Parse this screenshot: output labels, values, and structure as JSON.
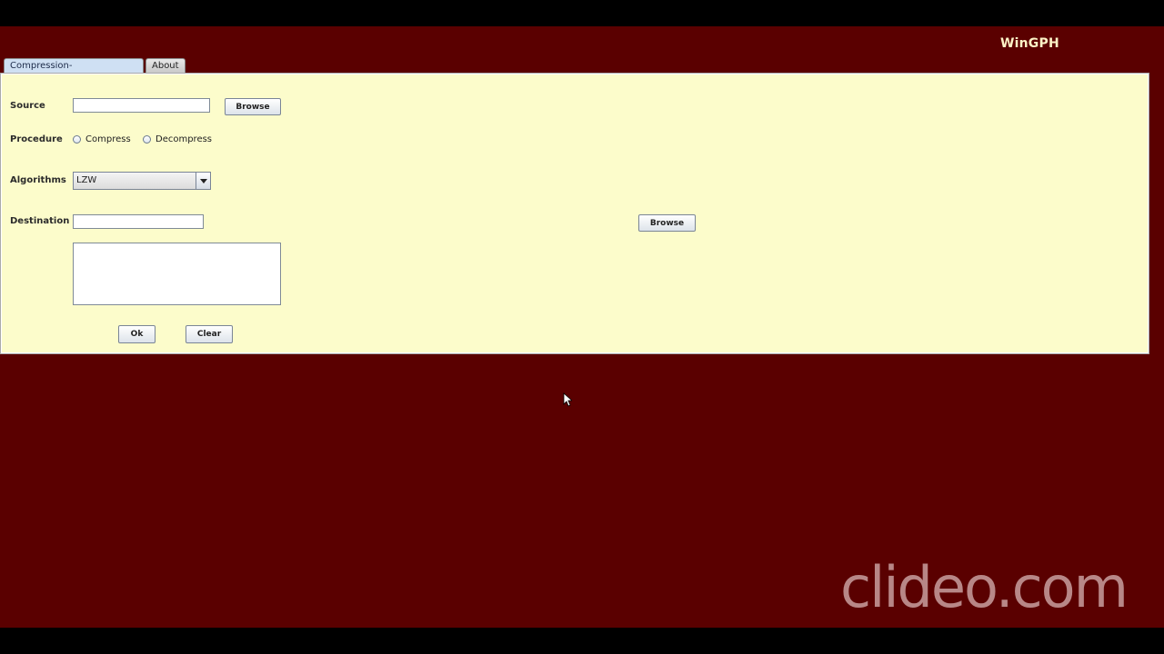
{
  "app": {
    "title": "WinGPH"
  },
  "tabs": [
    {
      "label": "Compression-Decompression",
      "active": true
    },
    {
      "label": "About",
      "active": false
    }
  ],
  "form": {
    "source_label": "Source",
    "source_value": "",
    "source_browse": "Browse",
    "procedure_label": "Procedure",
    "procedure_options": [
      "Compress",
      "Decompress"
    ],
    "algorithms_label": "Algorithms",
    "algorithm_selected": "LZW",
    "destination_label": "Destination",
    "destination_value": "",
    "destination_browse": "Browse",
    "output_text": "",
    "ok_label": "Ok",
    "clear_label": "Clear"
  },
  "watermark": "clideo.com",
  "colors": {
    "background": "#5a0000",
    "panel": "#fcfccb",
    "title": "#fdf3c7"
  }
}
